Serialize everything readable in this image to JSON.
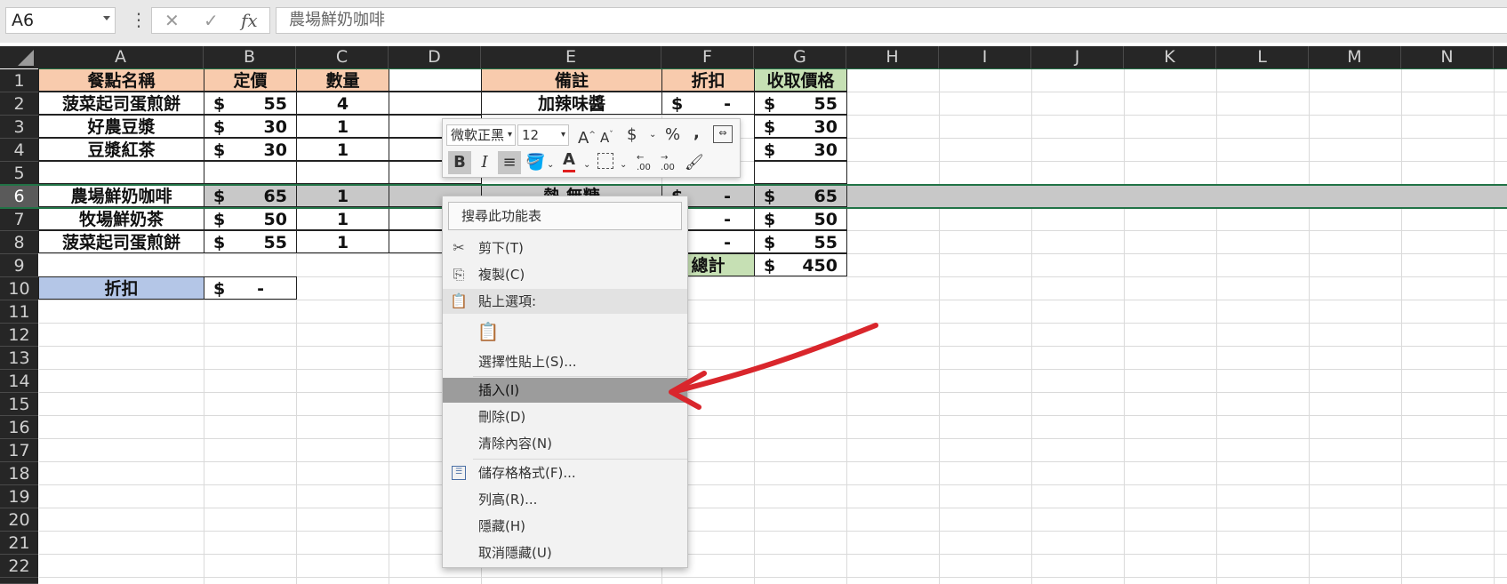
{
  "formula_bar": {
    "name_box": "A6",
    "cancel_icon": "✕",
    "enter_icon": "✓",
    "fx_icon": "fx",
    "formula": "農場鮮奶咖啡"
  },
  "columns": [
    "A",
    "B",
    "C",
    "D",
    "E",
    "F",
    "G",
    "H",
    "I",
    "J",
    "K",
    "L",
    "M",
    "N"
  ],
  "rows": [
    "1",
    "2",
    "3",
    "4",
    "5",
    "6",
    "7",
    "8",
    "9",
    "10",
    "11",
    "12",
    "13",
    "14",
    "15",
    "16",
    "17",
    "18",
    "19",
    "20",
    "21",
    "22"
  ],
  "headers": {
    "item": "餐點名稱",
    "price": "定價",
    "qty": "數量",
    "note": "備註",
    "discount": "折扣",
    "amount": "收取價格"
  },
  "orders": [
    {
      "item": "菠菜起司蛋煎餅",
      "cur": "$",
      "price": "55",
      "qty": "4",
      "note": "加辣味醬",
      "dcur": "$",
      "disc": "-",
      "acur": "$",
      "amount": "55"
    },
    {
      "item": "好農豆漿",
      "cur": "$",
      "price": "30",
      "qty": "1",
      "note": "",
      "dcur": "",
      "disc": "",
      "acur": "$",
      "amount": "30"
    },
    {
      "item": "豆漿紅茶",
      "cur": "$",
      "price": "30",
      "qty": "1",
      "note": "",
      "dcur": "",
      "disc": "",
      "acur": "$",
      "amount": "30"
    },
    {
      "item": "",
      "cur": "",
      "price": "",
      "qty": "",
      "note": "",
      "dcur": "",
      "disc": "",
      "acur": "",
      "amount": ""
    },
    {
      "item": "農場鮮奶咖啡",
      "cur": "$",
      "price": "65",
      "qty": "1",
      "note": "熱 無糖",
      "dcur": "$",
      "disc": "-",
      "acur": "$",
      "amount": "65"
    },
    {
      "item": "牧場鮮奶茶",
      "cur": "$",
      "price": "50",
      "qty": "1",
      "note": "",
      "dcur": "",
      "disc": "-",
      "acur": "$",
      "amount": "50"
    },
    {
      "item": "菠菜起司蛋煎餅",
      "cur": "$",
      "price": "55",
      "qty": "1",
      "note": "",
      "dcur": "",
      "disc": "-",
      "acur": "$",
      "amount": "55"
    }
  ],
  "total": {
    "label": "總計",
    "cur": "$",
    "value": "450"
  },
  "discount_row": {
    "label": "折扣",
    "cur": "$",
    "value": "-"
  },
  "colors": {
    "header_fill": "#f8cbad",
    "total_fill": "#c6e0b4",
    "discount_fill": "#b4c6e7",
    "grid_header": "#262626",
    "accent": "#217346",
    "arrow": "#d9262c"
  },
  "mini_toolbar": {
    "font_name": "微軟正黑",
    "font_size": "12",
    "grow_font": "A",
    "shrink_font": "A",
    "currency": "$",
    "percent": "%",
    "comma": ",",
    "bold": "B",
    "italic": "I",
    "font_color": "A",
    "inc_decimal": ".00",
    "dec_decimal": ".00"
  },
  "context_menu": {
    "search": "搜尋此功能表",
    "cut": "剪下(T)",
    "copy": "複製(C)",
    "paste_options": "貼上選項:",
    "paste_special": "選擇性貼上(S)...",
    "insert": "插入(I)",
    "delete": "刪除(D)",
    "clear": "清除內容(N)",
    "format_cells": "儲存格格式(F)...",
    "row_height": "列高(R)...",
    "hide": "隱藏(H)",
    "unhide": "取消隱藏(U)"
  }
}
